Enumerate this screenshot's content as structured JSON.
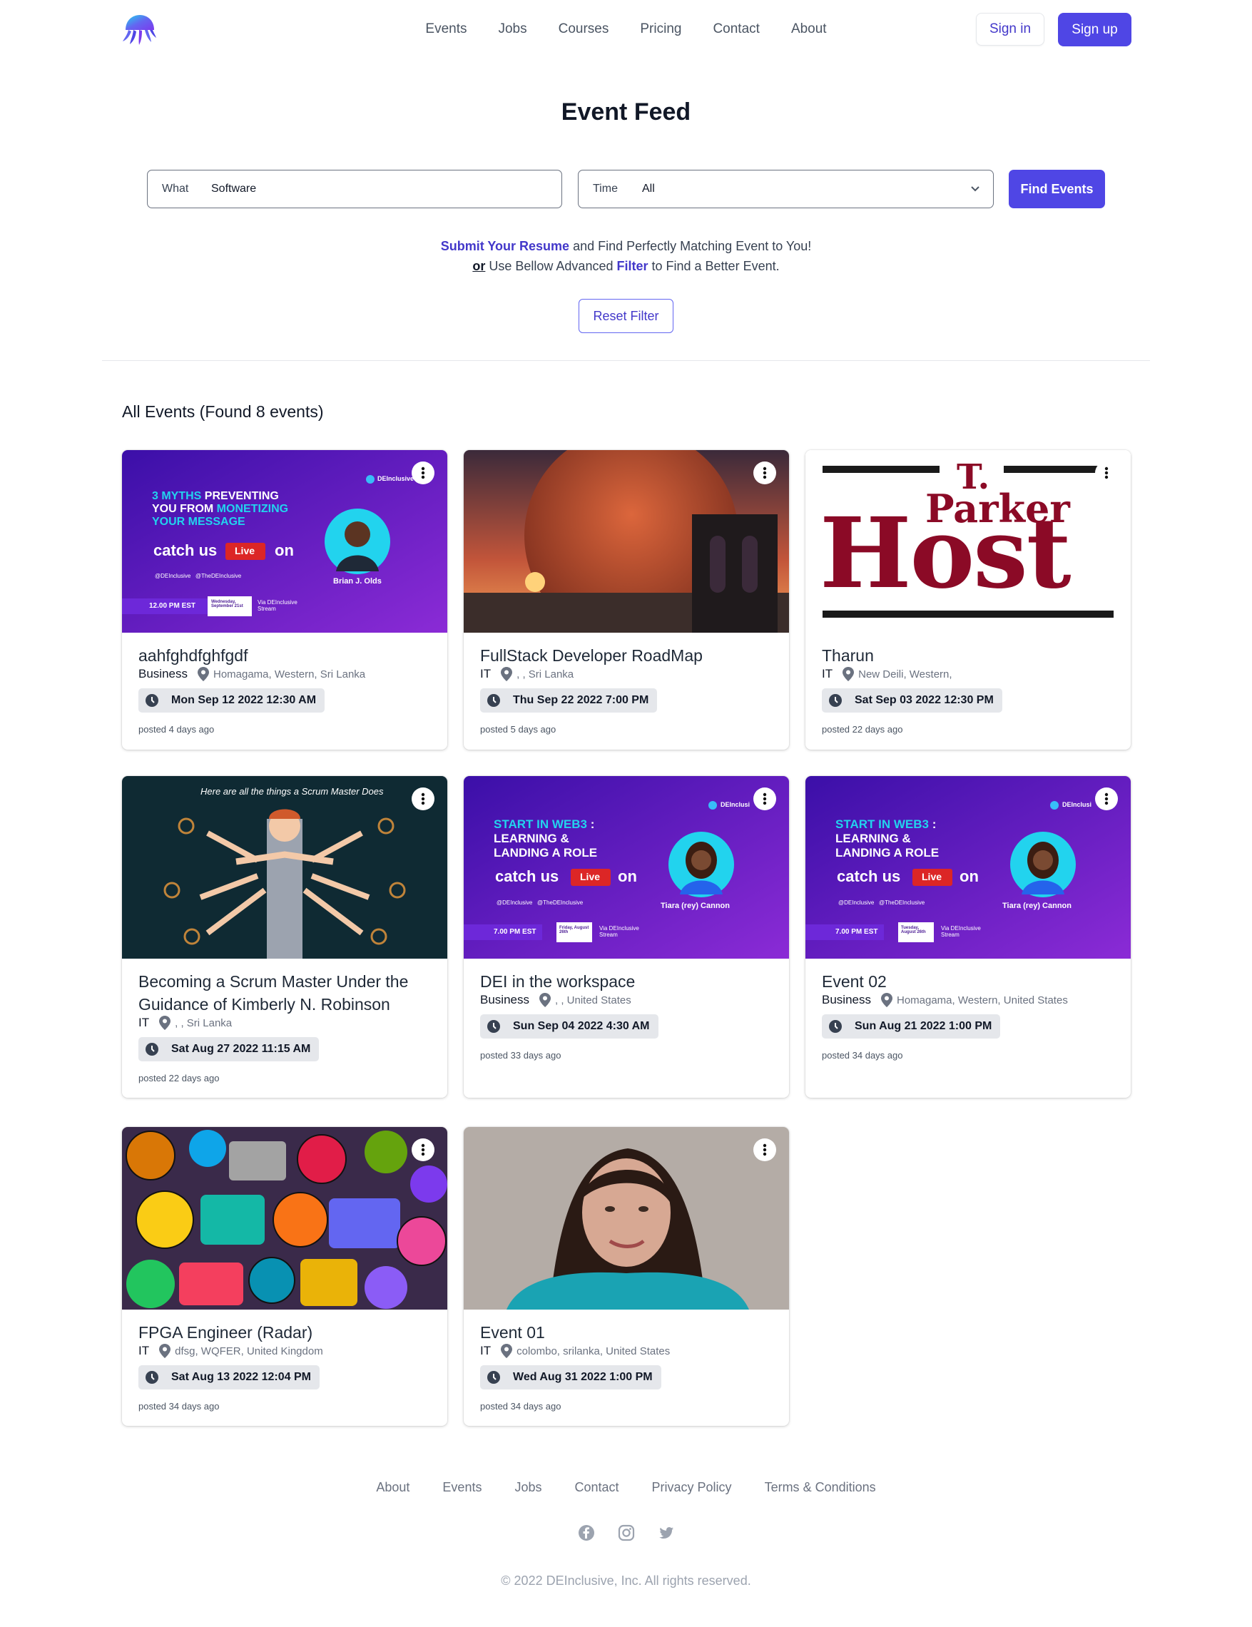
{
  "nav": {
    "links": [
      "Events",
      "Jobs",
      "Courses",
      "Pricing",
      "Contact",
      "About"
    ],
    "signin": "Sign in",
    "signup": "Sign up"
  },
  "page_title": "Event Feed",
  "search": {
    "what_label": "What",
    "what_value": "Software",
    "time_label": "Time",
    "time_value": "All",
    "find_button": "Find Events"
  },
  "promo": {
    "resume_link": "Submit Your Resume",
    "resume_text": " and Find Perfectly Matching Event to You!",
    "or": "or",
    "filter_pre": " Use Bellow Advanced ",
    "filter_link": "Filter",
    "filter_post": " to Find a Better Event.",
    "reset_button": "Reset Filter"
  },
  "results_heading": "All Events (Found 8 events)",
  "events": [
    {
      "name": "aahfghdfghfgdf",
      "category": "Business",
      "location": "Homagama, Western, Sri Lanka",
      "date": "Mon Sep 12 2022 12:30 AM",
      "posted": "posted 4 days ago"
    },
    {
      "name": "FullStack Developer RoadMap",
      "category": "IT",
      "location": ", , Sri Lanka",
      "date": "Thu Sep 22 2022 7:00 PM",
      "posted": "posted 5 days ago"
    },
    {
      "name": "Tharun",
      "category": "IT",
      "location": "New Deili, Western,",
      "date": "Sat Sep 03 2022 12:30 PM",
      "posted": "posted 22 days ago"
    },
    {
      "name": "Becoming a Scrum Master Under the Guidance of Kimberly N. Robinson",
      "category": "IT",
      "location": ", , Sri Lanka",
      "date": "Sat Aug 27 2022 11:15 AM",
      "posted": "posted 22 days ago"
    },
    {
      "name": "DEI in the workspace",
      "category": "Business",
      "location": ", , United States",
      "date": "Sun Sep 04 2022 4:30 AM",
      "posted": "posted 33 days ago"
    },
    {
      "name": "Event 02",
      "category": "Business",
      "location": "Homagama, Western, United States",
      "date": "Sun Aug 21 2022 1:00 PM",
      "posted": "posted 34 days ago"
    },
    {
      "name": "FPGA Engineer (Radar)",
      "category": "IT",
      "location": "dfsg, WQFER, United Kingdom",
      "date": "Sat Aug 13 2022 12:04 PM",
      "posted": "posted 34 days ago"
    },
    {
      "name": "Event 01",
      "category": "IT",
      "location": "colombo, srilanka, United States",
      "date": "Wed Aug 31 2022 1:00 PM",
      "posted": "posted 34 days ago"
    }
  ],
  "banners": {
    "myths": {
      "line1a": "3 MYTHS ",
      "line1b": "PREVENTING",
      "line2a": "YOU FROM ",
      "line2b": "MONETIZING",
      "line3": "YOUR MESSAGE",
      "catch": "catch us",
      "live": "Live",
      "on": "on",
      "handle1": "@DEInclusive",
      "handle2": "@TheDEInclusive",
      "time": "12.00 PM EST",
      "day": "Wednesday, September 21st",
      "via": "Via DEInclusive Stream",
      "speaker": "Brian J. Olds",
      "brand": "DEInclusive"
    },
    "web3": {
      "line1a": "START IN WEB3",
      "line1b": " :",
      "line2": "LEARNING &",
      "line3": "LANDING A ROLE",
      "catch": "catch us",
      "live": "Live",
      "on": "on",
      "handle1": "@DEInclusive",
      "handle2": "@TheDEInclusive",
      "time": "7.00 PM EST",
      "day1": "Friday, August 26th",
      "day2": "Tuesday, August 26th",
      "via": "Via DEInclusive Stream",
      "speaker": "Tiara (rey) Cannon",
      "brand": "DEInclusi"
    },
    "host": {
      "t": "T.",
      "parker": "Parker",
      "host": "Host"
    },
    "scrum": {
      "caption": "Here are all the things a Scrum Master Does"
    }
  },
  "footer": {
    "links": [
      "About",
      "Events",
      "Jobs",
      "Contact",
      "Privacy Policy",
      "Terms & Conditions"
    ],
    "socials": [
      "facebook-icon",
      "instagram-icon",
      "twitter-icon"
    ],
    "copyright": "© 2022 DEInclusive, Inc. All rights reserved."
  },
  "colors": {
    "primary": "#4f46e5",
    "primary_text": "#4338ca"
  }
}
